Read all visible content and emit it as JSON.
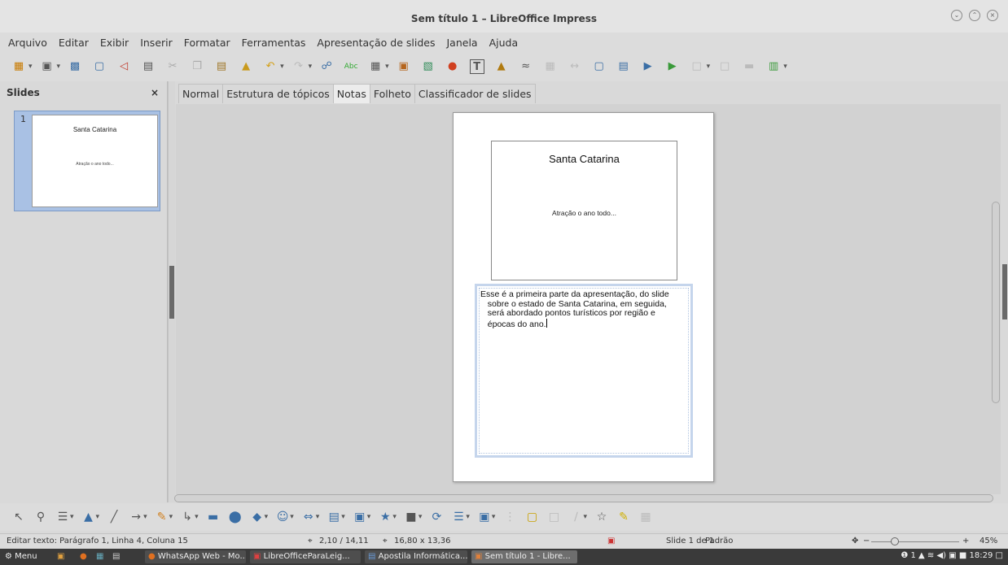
{
  "window": {
    "title": "Sem título 1 – LibreOffice Impress"
  },
  "menu": [
    "Arquivo",
    "Editar",
    "Exibir",
    "Inserir",
    "Formatar",
    "Ferramentas",
    "Apresentação de slides",
    "Janela",
    "Ajuda"
  ],
  "slides_panel": {
    "title": "Slides",
    "close": "×",
    "thumb": {
      "number": "1",
      "title": "Santa Catarina",
      "subtitle": "Atração o ano todo..."
    }
  },
  "view_tabs": [
    "Normal",
    "Estrutura de tópicos",
    "Notas",
    "Folheto",
    "Classificador de slides"
  ],
  "active_tab": "Notas",
  "notes_page": {
    "slide_title": "Santa Catarina",
    "slide_subtitle": "Atração o ano todo...",
    "notes_text": "Esse é a primeira parte da apresentação, do slide\n   sobre o estado de Santa Catarina, em seguida,\n   será abordado pontos turísticos por região e\n   épocas do ano."
  },
  "statusbar": {
    "edit_info": "Editar texto: Parágrafo 1, Linha 4, Coluna 15",
    "position": "2,10 / 14,11",
    "size": "16,80 x 13,36",
    "slide": "Slide 1 de 1",
    "layout": "Padrão",
    "zoom": "45%"
  },
  "taskbar": {
    "menu": "Menu",
    "apps": [
      "WhatsApp Web - Mo...",
      "LibreOfficeParaLeig...",
      "Apostila Informática...",
      "Sem título 1 - Libre..."
    ],
    "tray_icons": "❶ 1 ▲ ≋ ◀) ▣ ■",
    "clock": "18:29"
  }
}
